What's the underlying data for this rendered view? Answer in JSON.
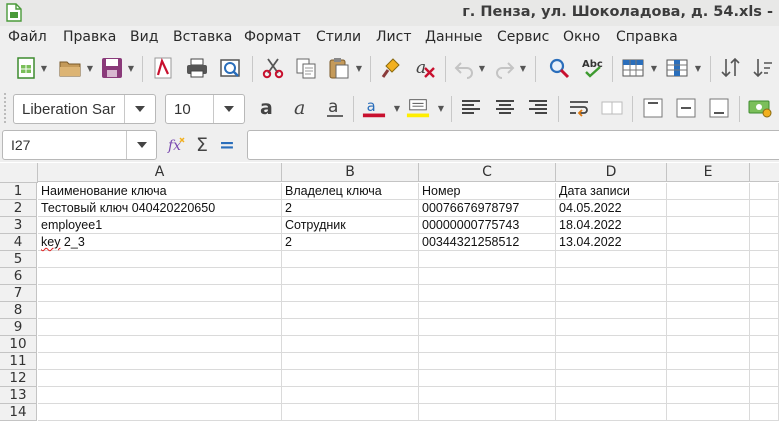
{
  "window": {
    "title": "г. Пенза, ул. Шоколадова, д. 54.xls -"
  },
  "menu": [
    "Файл",
    "Правка",
    "Вид",
    "Вставка",
    "Формат",
    "Стили",
    "Лист",
    "Данные",
    "Сервис",
    "Окно",
    "Справка"
  ],
  "toolbar": {
    "font_name": "Liberation Sar",
    "font_size": "10"
  },
  "formula_bar": {
    "cell_reference": "I27",
    "formula": ""
  },
  "sheet": {
    "columns": [
      "A",
      "B",
      "C",
      "D",
      "E"
    ],
    "rows": [
      "1",
      "2",
      "3",
      "4",
      "5",
      "6",
      "7",
      "8",
      "9",
      "10",
      "11",
      "12",
      "13",
      "14"
    ],
    "cells": [
      [
        "Наименование ключа",
        "Владелец ключа",
        "Номер",
        "Дата записи",
        ""
      ],
      [
        "Тестовый ключ 040420220650",
        "2",
        "00076676978797",
        "04.05.2022",
        ""
      ],
      [
        "employee1",
        "Сотрудник",
        "00000000775743",
        "18.04.2022",
        ""
      ],
      [
        "key 2_3",
        "2",
        "00344321258512",
        "13.04.2022",
        ""
      ]
    ]
  },
  "colors": {
    "font_color_bar": "#c8102e",
    "highlight_bar": "#ffee00",
    "accent": "#2a6ebb"
  }
}
